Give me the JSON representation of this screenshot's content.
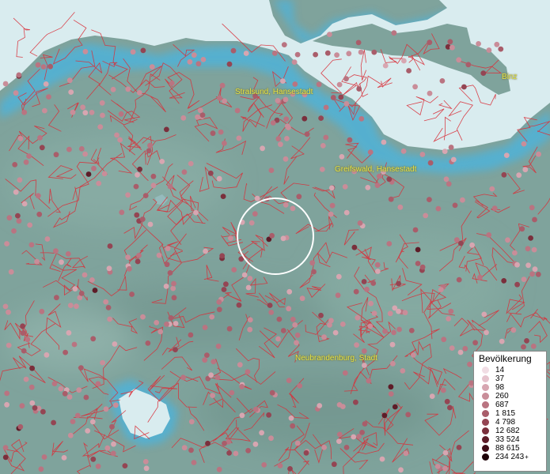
{
  "map": {
    "colors": {
      "land": "#7fa39c",
      "water": "#d9ecef",
      "coast_glow": "#5fb6d6",
      "boundaries": "#d9303a",
      "label_text": "#e8e84a"
    },
    "cities": [
      {
        "name": "Stralsund, Hansestadt"
      },
      {
        "name": "Greifswald, Hansestadt"
      },
      {
        "name": "Neubrandenburg, Stadt"
      },
      {
        "name": "Binz"
      }
    ]
  },
  "legend": {
    "title": "Bevölkerung",
    "entries": [
      {
        "label": "14",
        "color": "#f1dde4"
      },
      {
        "label": "37",
        "color": "#e6c3cd"
      },
      {
        "label": "98",
        "color": "#d7a6b1"
      },
      {
        "label": "260",
        "color": "#c98d99"
      },
      {
        "label": "687",
        "color": "#b97481"
      },
      {
        "label": "1 815",
        "color": "#a95d6a"
      },
      {
        "label": "4 798",
        "color": "#944553"
      },
      {
        "label": "12 682",
        "color": "#7a2f3c"
      },
      {
        "label": "33 524",
        "color": "#5e1c28"
      },
      {
        "label": "88 615",
        "color": "#3f0c16"
      },
      {
        "label": "234 243",
        "color": "#1e0308"
      }
    ],
    "overflow_marker": "+"
  }
}
